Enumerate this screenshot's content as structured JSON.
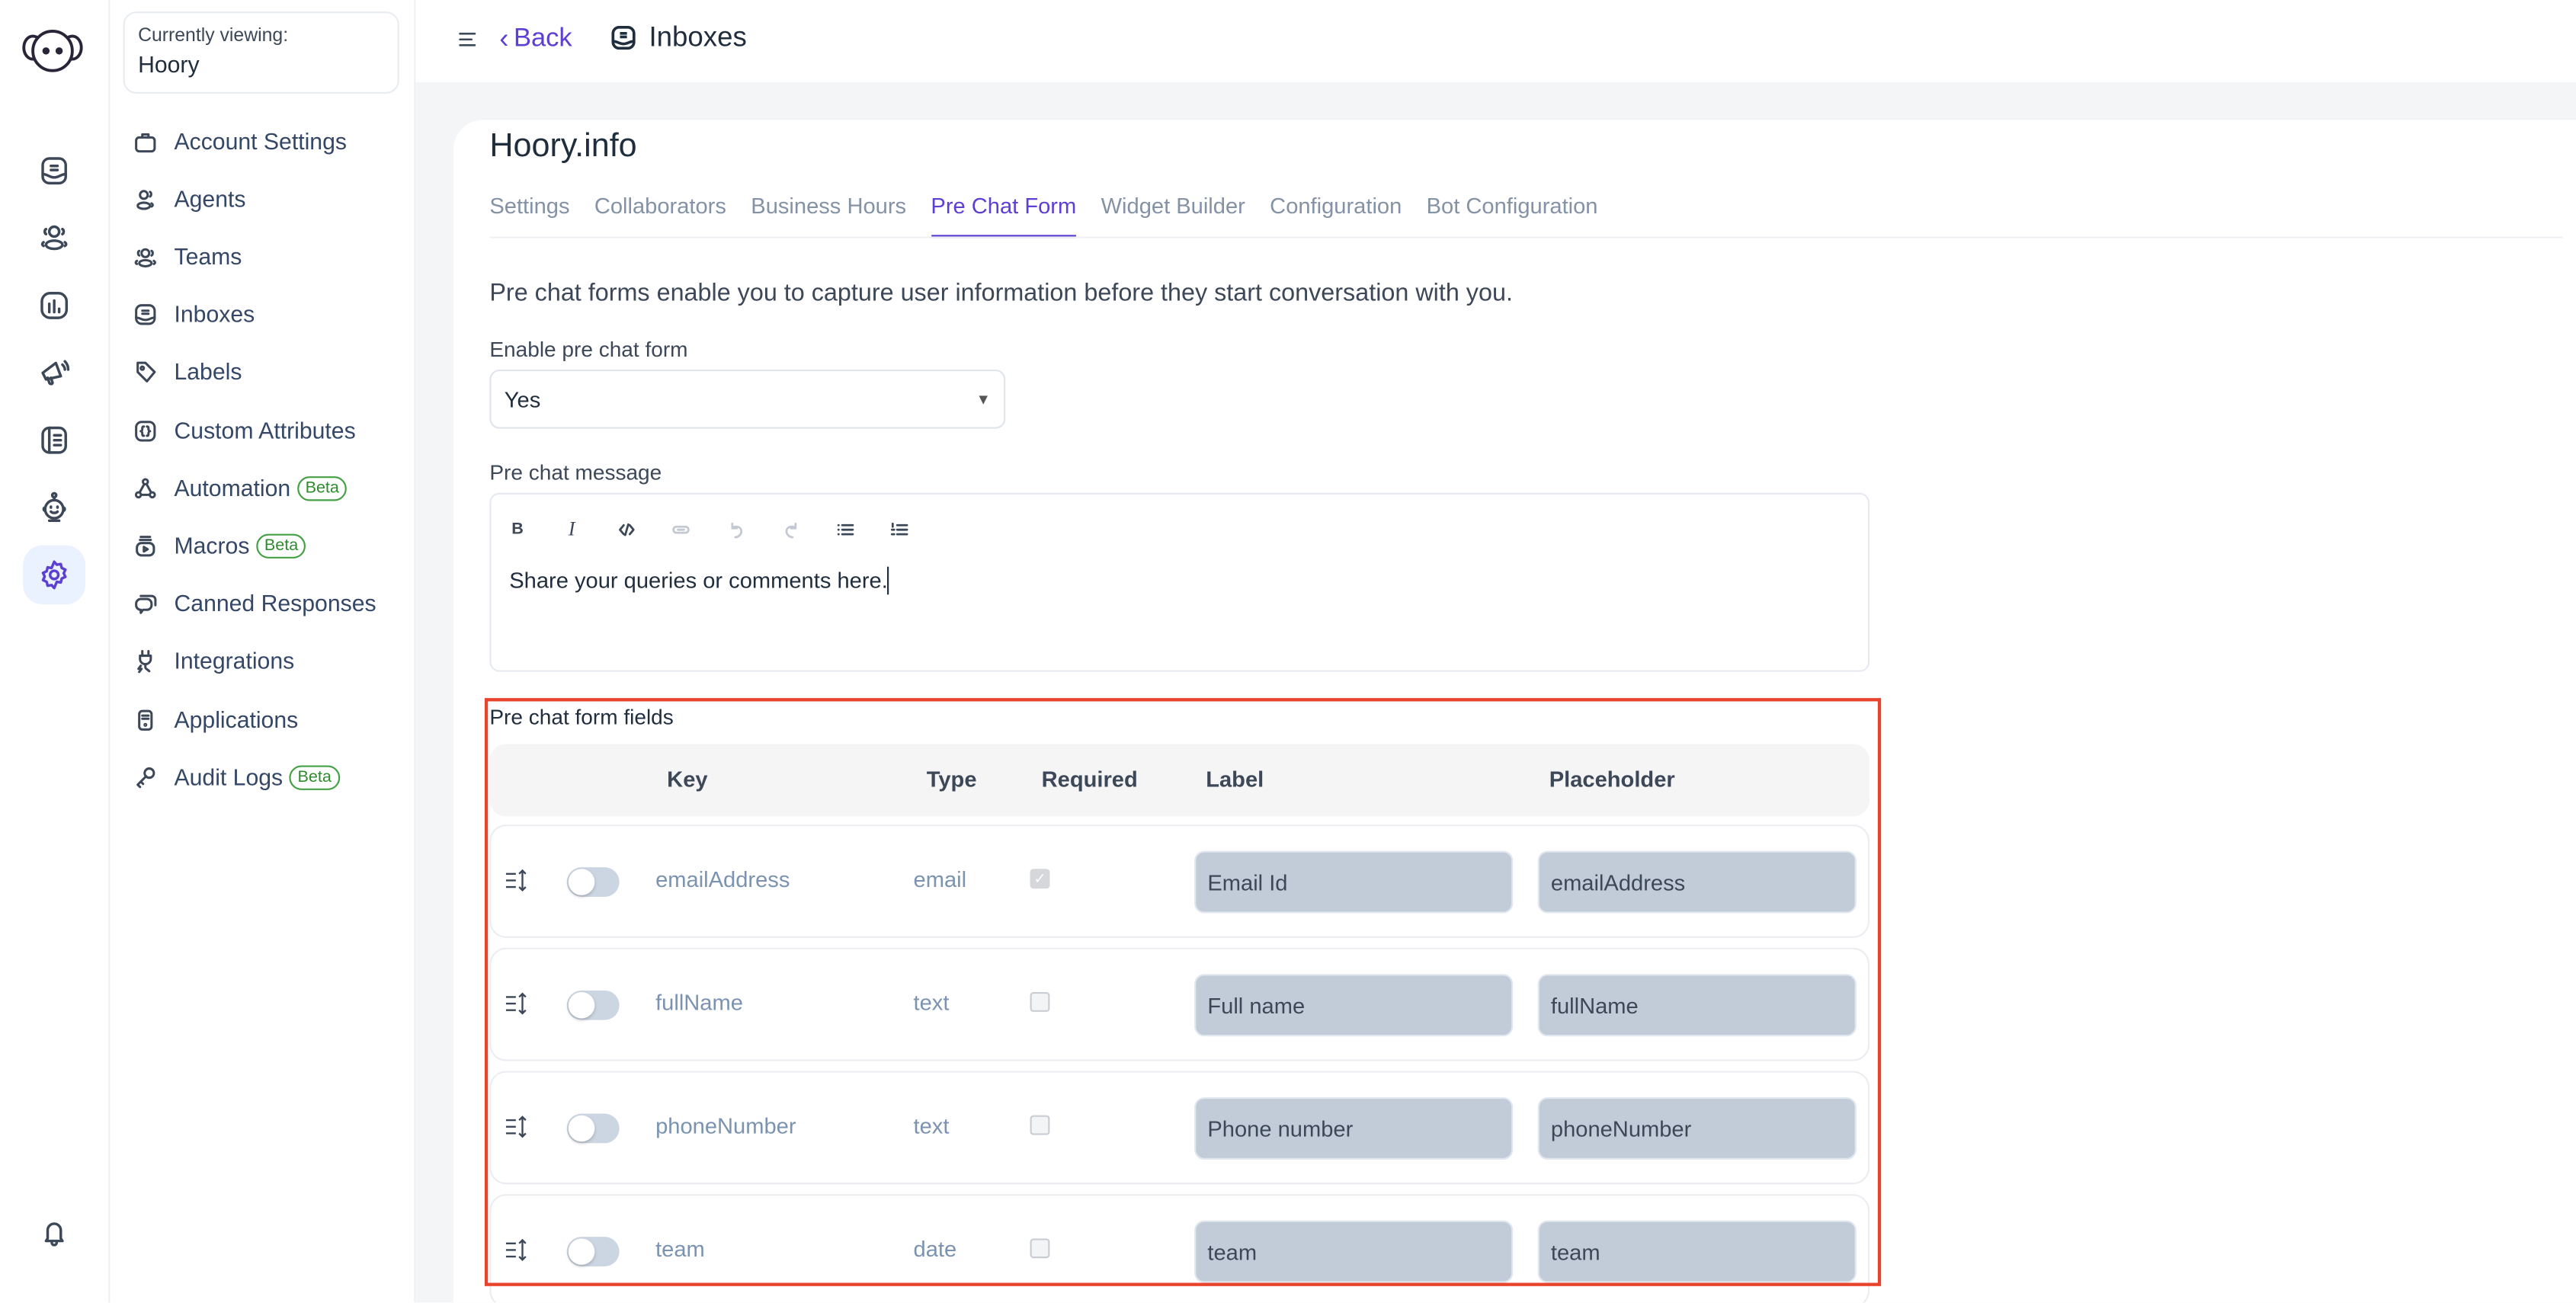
{
  "account": {
    "currently_viewing_label": "Currently viewing:",
    "name": "Hoory"
  },
  "primary_nav": [
    {
      "name": "conversations",
      "icon": "inbox-icon"
    },
    {
      "name": "contacts",
      "icon": "contacts-icon"
    },
    {
      "name": "reports",
      "icon": "reports-icon"
    },
    {
      "name": "campaigns",
      "icon": "megaphone-icon"
    },
    {
      "name": "help-center",
      "icon": "book-icon"
    },
    {
      "name": "bot",
      "icon": "bot-icon"
    },
    {
      "name": "settings",
      "icon": "gear-icon",
      "active": true
    },
    {
      "name": "notifications",
      "icon": "bell-icon"
    }
  ],
  "settings_nav": [
    {
      "label": "Account Settings",
      "icon": "briefcase-icon"
    },
    {
      "label": "Agents",
      "icon": "agents-icon"
    },
    {
      "label": "Teams",
      "icon": "teams-icon"
    },
    {
      "label": "Inboxes",
      "icon": "inbox-icon"
    },
    {
      "label": "Labels",
      "icon": "tag-icon"
    },
    {
      "label": "Custom Attributes",
      "icon": "braces-icon"
    },
    {
      "label": "Automation",
      "icon": "automation-icon",
      "badge": "Beta"
    },
    {
      "label": "Macros",
      "icon": "macros-icon",
      "badge": "Beta"
    },
    {
      "label": "Canned Responses",
      "icon": "chat-bubbles-icon"
    },
    {
      "label": "Integrations",
      "icon": "plug-icon"
    },
    {
      "label": "Applications",
      "icon": "app-icon"
    },
    {
      "label": "Audit Logs",
      "icon": "key-icon",
      "badge": "Beta"
    }
  ],
  "header": {
    "back_label": "Back",
    "breadcrumb": "Inboxes"
  },
  "page": {
    "title": "Hoory.info",
    "tabs": [
      {
        "label": "Settings"
      },
      {
        "label": "Collaborators"
      },
      {
        "label": "Business Hours"
      },
      {
        "label": "Pre Chat Form",
        "active": true
      },
      {
        "label": "Widget Builder"
      },
      {
        "label": "Configuration"
      },
      {
        "label": "Bot Configuration"
      }
    ],
    "description": "Pre chat forms enable you to capture user information before they start conversation with you.",
    "enable_label": "Enable pre chat form",
    "enable_value": "Yes",
    "message_label": "Pre chat message",
    "message_value": "Share your queries or comments here.",
    "editor_toolbar": [
      "bold",
      "italic",
      "code",
      "link",
      "undo",
      "redo",
      "bullet-list",
      "ordered-list"
    ],
    "fields_title": "Pre chat form fields",
    "columns": {
      "key": "Key",
      "type": "Type",
      "required": "Required",
      "label": "Label",
      "placeholder": "Placeholder"
    },
    "fields": [
      {
        "key": "emailAddress",
        "type": "email",
        "enabled": false,
        "required": true,
        "label": "Email Id",
        "placeholder": "emailAddress"
      },
      {
        "key": "fullName",
        "type": "text",
        "enabled": false,
        "required": false,
        "label": "Full name",
        "placeholder": "fullName"
      },
      {
        "key": "phoneNumber",
        "type": "text",
        "enabled": false,
        "required": false,
        "label": "Phone number",
        "placeholder": "phoneNumber"
      },
      {
        "key": "team",
        "type": "date",
        "enabled": false,
        "required": false,
        "label": "team",
        "placeholder": "team"
      }
    ]
  },
  "colors": {
    "accent": "#5d3fd3",
    "highlight_box": "#e8432c",
    "beta": "#2e8b2e"
  }
}
